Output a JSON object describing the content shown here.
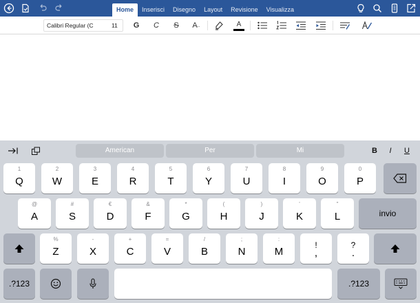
{
  "ribbon": {
    "tabs": [
      "Home",
      "Inserisci",
      "Disegno",
      "Layout",
      "Revisione",
      "Visualizza"
    ],
    "active_tab": "Home",
    "left_icons": [
      "back-icon",
      "file-icon",
      "undo-icon",
      "redo-icon"
    ],
    "right_icons": [
      "lightbulb-icon",
      "search-icon",
      "phone-icon",
      "share-icon"
    ],
    "color": "#2b579a"
  },
  "toolbar": {
    "font_name": "Calibri Regular (C",
    "font_size": "11",
    "bold": "G",
    "italic": "C",
    "strike": "S",
    "text_size": "A",
    "font_color": "A",
    "font_color_swatch": "#000000"
  },
  "keyboard": {
    "suggestions": [
      "American",
      "Per",
      "Mi"
    ],
    "format_buttons": {
      "bold": "B",
      "italic": "I",
      "underline": "U"
    },
    "row1": [
      {
        "hint": "1",
        "key": "Q"
      },
      {
        "hint": "2",
        "key": "W"
      },
      {
        "hint": "3",
        "key": "E"
      },
      {
        "hint": "4",
        "key": "R"
      },
      {
        "hint": "5",
        "key": "T"
      },
      {
        "hint": "6",
        "key": "Y"
      },
      {
        "hint": "7",
        "key": "U"
      },
      {
        "hint": "8",
        "key": "I"
      },
      {
        "hint": "9",
        "key": "O"
      },
      {
        "hint": "0",
        "key": "P"
      }
    ],
    "row2": [
      {
        "hint": "@",
        "key": "A"
      },
      {
        "hint": "#",
        "key": "S"
      },
      {
        "hint": "€",
        "key": "D"
      },
      {
        "hint": "&",
        "key": "F"
      },
      {
        "hint": "*",
        "key": "G"
      },
      {
        "hint": "(",
        "key": "H"
      },
      {
        "hint": ")",
        "key": "J"
      },
      {
        "hint": "'",
        "key": "K"
      },
      {
        "hint": "\"",
        "key": "L"
      }
    ],
    "row3": [
      {
        "hint": "%",
        "key": "Z"
      },
      {
        "hint": "-",
        "key": "X"
      },
      {
        "hint": "+",
        "key": "C"
      },
      {
        "hint": "=",
        "key": "V"
      },
      {
        "hint": "/",
        "key": "B"
      },
      {
        "hint": ";",
        "key": "N"
      },
      {
        "hint": ":",
        "key": "M"
      },
      {
        "hint": "!",
        "key": ","
      },
      {
        "hint": "?",
        "key": "."
      }
    ],
    "return_label": "invio",
    "numbers_label": ".?123"
  }
}
